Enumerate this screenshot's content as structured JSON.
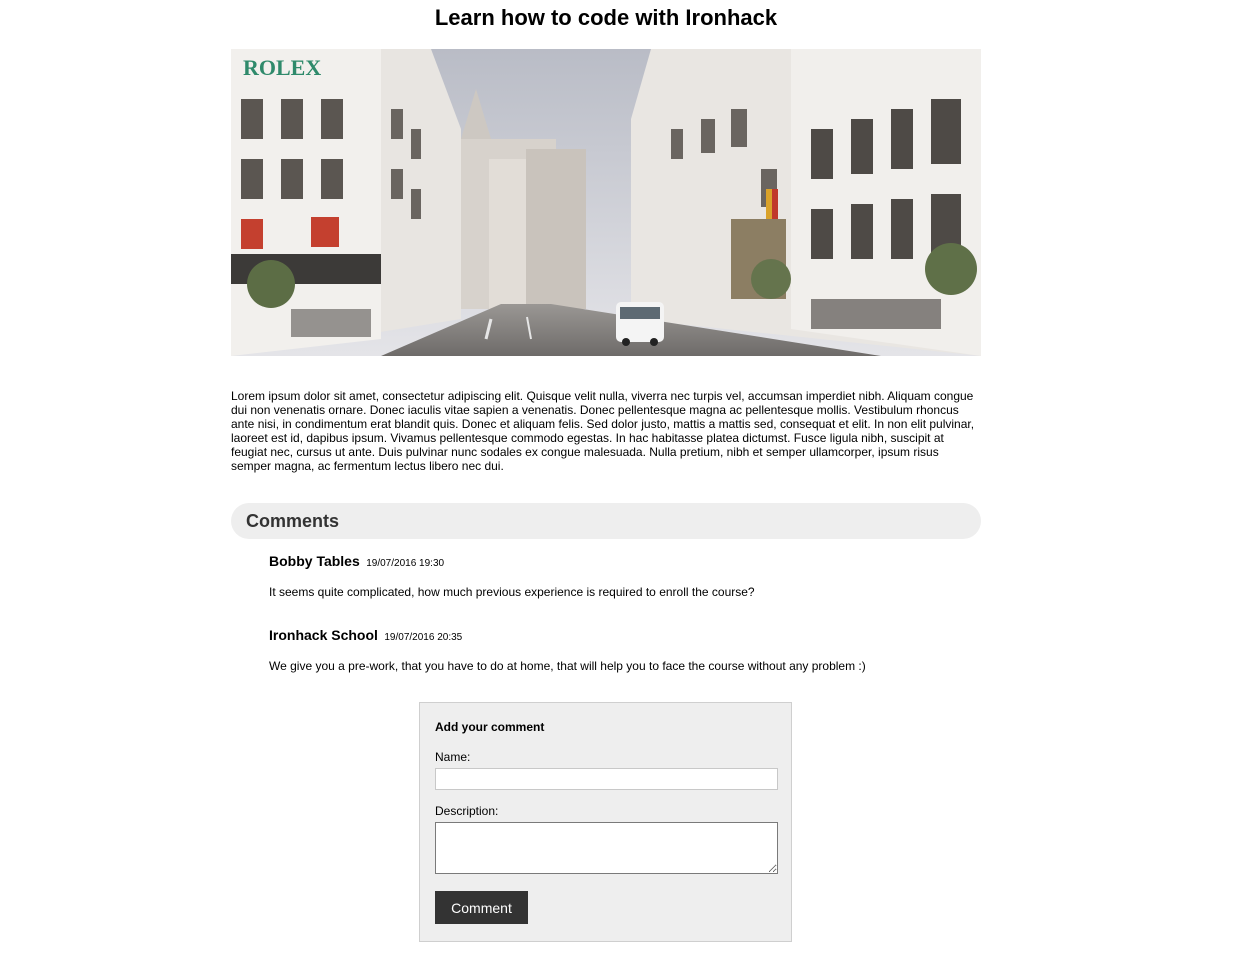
{
  "page": {
    "title": "Learn how to code with Ironhack"
  },
  "hero": {
    "sign_text": "ROLEX"
  },
  "article": {
    "body": "Lorem ipsum dolor sit amet, consectetur adipiscing elit. Quisque velit nulla, viverra nec turpis vel, accumsan imperdiet nibh. Aliquam congue dui non venenatis ornare. Donec iaculis vitae sapien a venenatis. Donec pellentesque magna ac pellentesque mollis. Vestibulum rhoncus ante nisi, in condimentum erat blandit quis. Donec et aliquam felis. Sed dolor justo, mattis a mattis sed, consequat et elit. In non elit pulvinar, laoreet est id, dapibus ipsum. Vivamus pellentesque commodo egestas. In hac habitasse platea dictumst. Fusce ligula nibh, suscipit at feugiat nec, cursus ut ante. Duis pulvinar nunc sodales ex congue malesuada. Nulla pretium, nibh et semper ullamcorper, ipsum risus semper magna, ac fermentum lectus libero nec dui."
  },
  "comments": {
    "heading": "Comments",
    "items": [
      {
        "author": "Bobby Tables",
        "date": "19/07/2016 19:30",
        "text": "It seems quite complicated, how much previous experience is required to enroll the course?"
      },
      {
        "author": "Ironhack School",
        "date": "19/07/2016 20:35",
        "text": "We give you a pre-work, that you have to do at home, that will help you to face the course without any problem :)"
      }
    ]
  },
  "form": {
    "title": "Add your comment",
    "name_label": "Name:",
    "name_value": "",
    "description_label": "Description:",
    "description_value": "",
    "submit_label": "Comment"
  },
  "colors": {
    "comments_bar_bg": "#eeeeee",
    "form_bg": "#eeeeee",
    "button_bg": "#333333",
    "button_text": "#ffffff"
  }
}
